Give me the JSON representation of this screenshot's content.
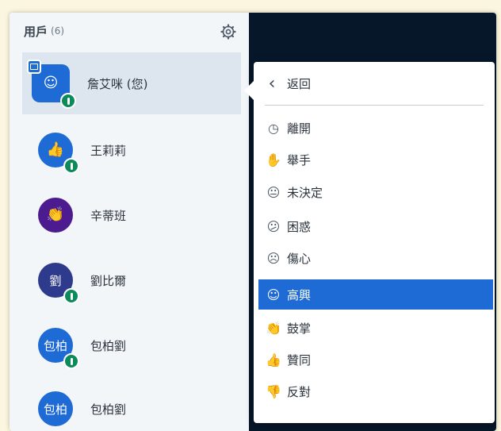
{
  "userlist": {
    "title": "用戶",
    "count": "(6)",
    "users": [
      {
        "name": "詹艾咪 (您)",
        "avatar_text": "",
        "avatar_icon": "smile-face",
        "color": "#1e6bd6",
        "presenter": true,
        "voice": true
      },
      {
        "name": "王莉莉",
        "avatar_text": "",
        "avatar_icon": "thumbs-up",
        "color": "#1e6bd6",
        "presenter": false,
        "voice": true
      },
      {
        "name": "辛蒂班",
        "avatar_text": "",
        "avatar_icon": "clap",
        "color": "#4b1b8f",
        "presenter": false,
        "voice": false
      },
      {
        "name": "劉比爾",
        "avatar_text": "劉",
        "avatar_icon": "",
        "color": "#2e3a8c",
        "presenter": false,
        "voice": true
      },
      {
        "name": "包柏劉",
        "avatar_text": "包柏",
        "avatar_icon": "",
        "color": "#1e6bd6",
        "presenter": false,
        "voice": true
      },
      {
        "name": "包柏劉",
        "avatar_text": "包柏",
        "avatar_icon": "",
        "color": "#1e6bd6",
        "presenter": false,
        "voice": false
      }
    ]
  },
  "status_menu": {
    "back_label": "返回",
    "items": [
      {
        "label": "離開",
        "icon": "clock-icon",
        "glyph": "◷"
      },
      {
        "label": "舉手",
        "icon": "raise-hand-icon",
        "glyph": "✋"
      },
      {
        "label": "未決定",
        "icon": "neutral-face-icon",
        "glyph": "😐"
      },
      {
        "label": "困惑",
        "icon": "confused-face-icon",
        "glyph": "😕"
      },
      {
        "label": "傷心",
        "icon": "sad-face-icon",
        "glyph": "☹"
      },
      {
        "label": "高興",
        "icon": "happy-face-icon",
        "glyph": "☺"
      },
      {
        "label": "鼓掌",
        "icon": "applause-icon",
        "glyph": "👏"
      },
      {
        "label": "贊同",
        "icon": "thumbs-up-icon",
        "glyph": "👍"
      },
      {
        "label": "反對",
        "icon": "thumbs-down-icon",
        "glyph": "👎"
      }
    ],
    "selected_label": "高興"
  },
  "colors": {
    "accent": "#1e6bd6",
    "panel": "#f3f6f9",
    "stage": "#06172a"
  }
}
